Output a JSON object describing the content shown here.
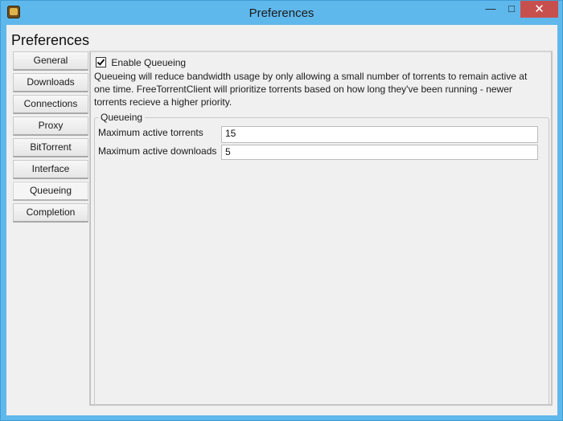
{
  "window": {
    "title": "Preferences",
    "minimize_glyph": "—",
    "maximize_glyph": "□",
    "close_glyph": "✕"
  },
  "page": {
    "heading": "Preferences"
  },
  "tabs": [
    {
      "label": "General"
    },
    {
      "label": "Downloads"
    },
    {
      "label": "Connections"
    },
    {
      "label": "Proxy"
    },
    {
      "label": "BitTorrent"
    },
    {
      "label": "Interface"
    },
    {
      "label": "Queueing"
    },
    {
      "label": "Completion"
    }
  ],
  "selected_tab": "Queueing",
  "queueing": {
    "enable_label": "Enable Queueing",
    "enabled": true,
    "description": "Queueing will reduce bandwidth usage by only allowing a small number of torrents to remain active at one time. FreeTorrentClient will prioritize torrents based on how long they've been running - newer torrents recieve a higher priority.",
    "group_title": "Queueing",
    "max_active_torrents_label": "Maximum active torrents",
    "max_active_torrents_value": "15",
    "max_active_downloads_label": "Maximum active downloads",
    "max_active_downloads_value": "5"
  }
}
